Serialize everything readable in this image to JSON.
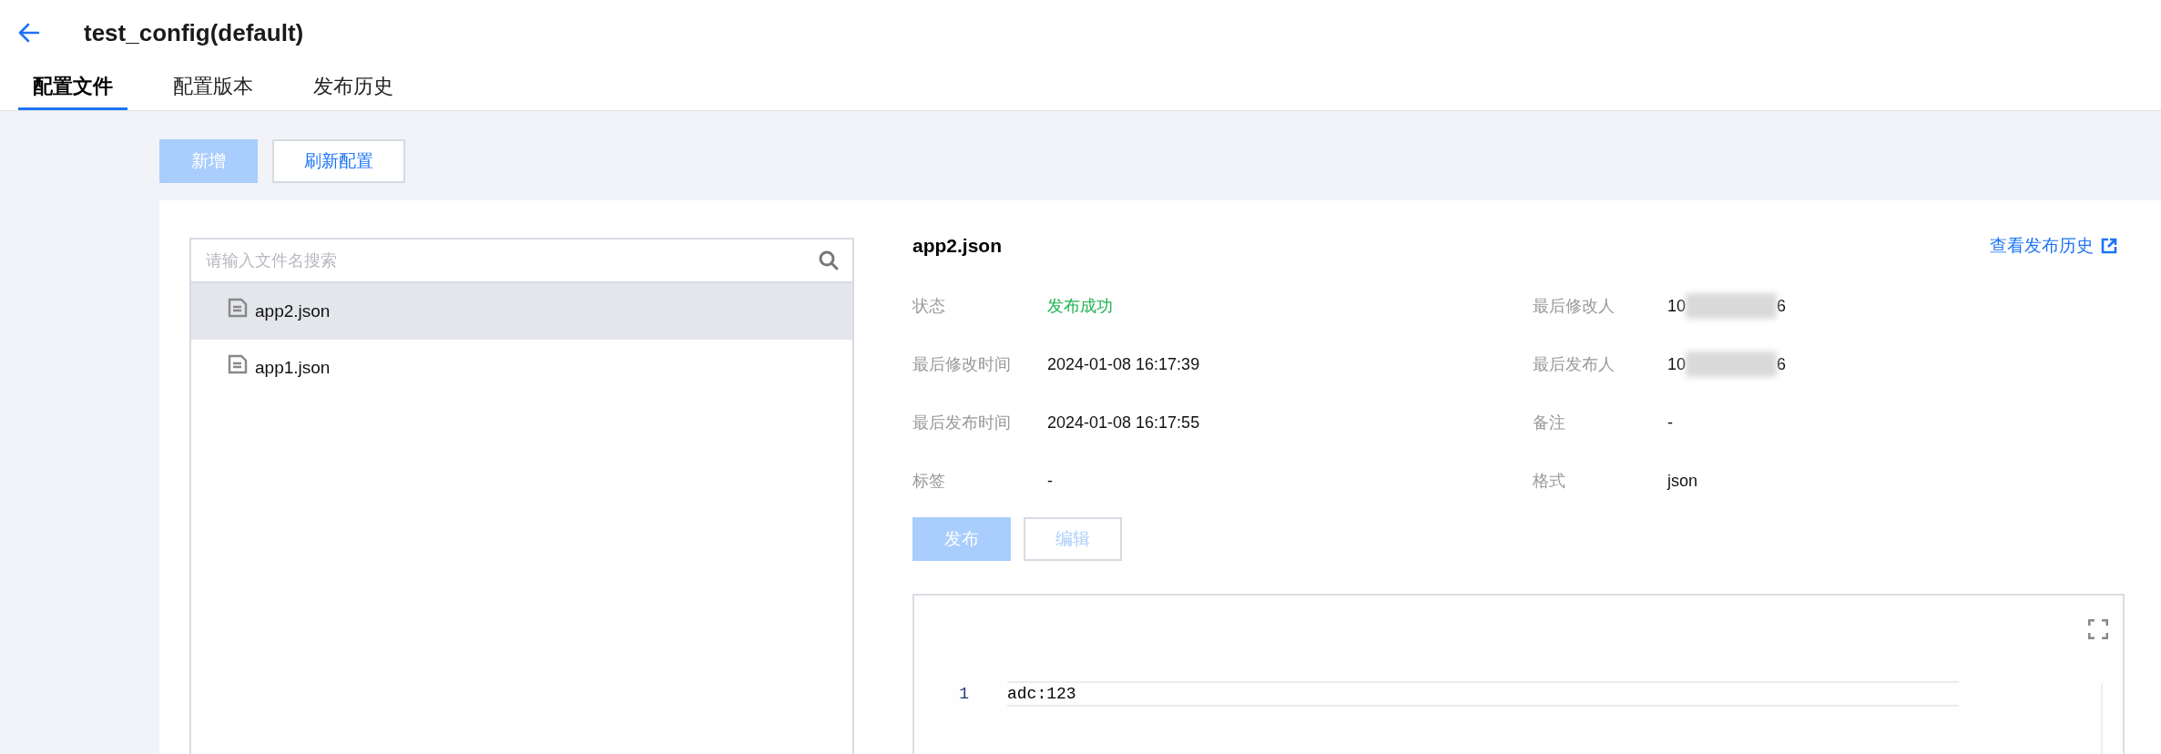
{
  "header": {
    "title": "test_config(default)"
  },
  "tabs": [
    {
      "label": "配置文件",
      "selected": true
    },
    {
      "label": "配置版本",
      "selected": false
    },
    {
      "label": "发布历史",
      "selected": false
    }
  ],
  "toolbar": {
    "buttons": [
      {
        "label": "新增",
        "kind": "primary",
        "disabled": true
      },
      {
        "label": "刷新配置",
        "kind": "default",
        "disabled": false
      }
    ]
  },
  "file_list": {
    "search": {
      "placeholder": "请输入文件名搜索"
    },
    "items": [
      {
        "name": "app2.json",
        "selected": true
      },
      {
        "name": "app1.json",
        "selected": false
      }
    ]
  },
  "detail": {
    "title": "app2.json",
    "history_link": "查看发布历史",
    "fields": [
      {
        "label": "状态",
        "value": "发布成功",
        "kind": "status"
      },
      {
        "label": "最后修改人",
        "value": "10",
        "value_end": "6",
        "kind": "masked"
      },
      {
        "label": "最后修改时间",
        "value": "2024-01-08 16:17:39",
        "kind": "text"
      },
      {
        "label": "最后发布人",
        "value": "10",
        "value_end": "6",
        "kind": "masked"
      },
      {
        "label": "最后发布时间",
        "value": "2024-01-08 16:17:55",
        "kind": "text"
      },
      {
        "label": "备注",
        "value": "-",
        "kind": "text"
      },
      {
        "label": "标签",
        "value": "-",
        "kind": "text"
      },
      {
        "label": "格式",
        "value": "json",
        "kind": "text"
      }
    ],
    "buttons": [
      {
        "label": "发布",
        "kind": "primary",
        "disabled": true
      },
      {
        "label": "编辑",
        "kind": "default",
        "disabled": true
      }
    ],
    "editor": {
      "lines": [
        {
          "number": "1",
          "code": "adc:123"
        }
      ]
    }
  }
}
